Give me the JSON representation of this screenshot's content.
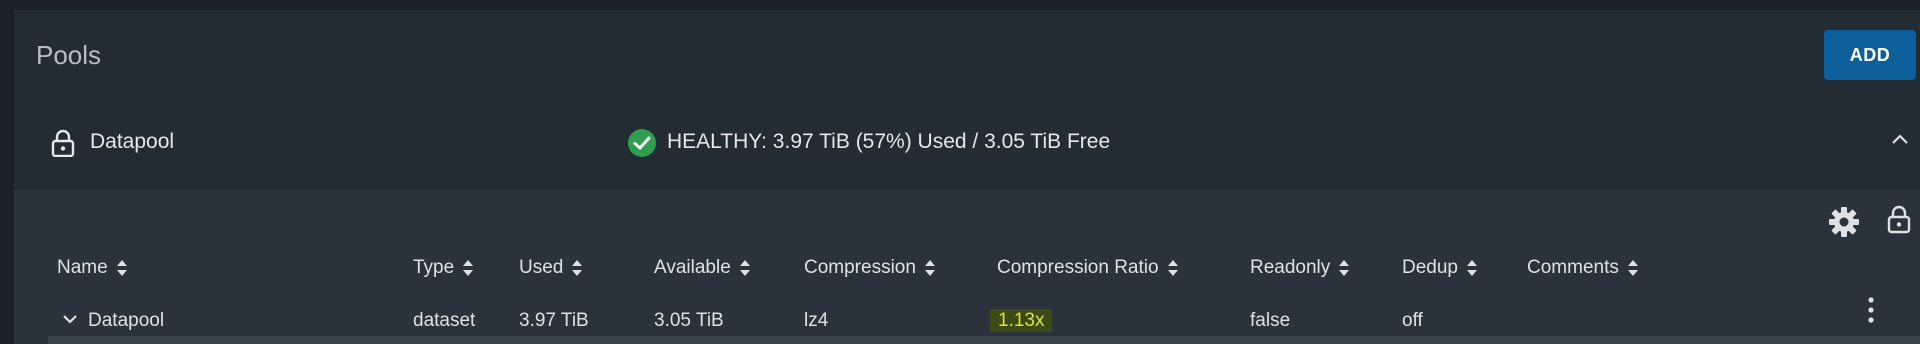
{
  "page": {
    "title": "Pools",
    "add_label": "ADD"
  },
  "pool": {
    "name": "Datapool",
    "status": "HEALTHY: 3.97 TiB (57%) Used / 3.05 TiB Free",
    "status_color": "#2e9e4f"
  },
  "table": {
    "headers": [
      "Name",
      "Type",
      "Used",
      "Available",
      "Compression",
      "Compression Ratio",
      "Readonly",
      "Dedup",
      "Comments"
    ],
    "rows": [
      {
        "name": "Datapool",
        "type": "dataset",
        "used": "3.97 TiB",
        "available": "3.05 TiB",
        "compression": "lz4",
        "compression_ratio": "1.13x",
        "readonly": "false",
        "dedup": "off",
        "comments": ""
      }
    ]
  },
  "colors": {
    "accent": "#0d5f9c",
    "highlight": "#d8e635"
  },
  "icons": [
    "lock-icon",
    "check-circle-icon",
    "chevron-up-icon",
    "gear-icon",
    "sort-icon",
    "chevron-down-icon",
    "more-vertical-icon"
  ]
}
